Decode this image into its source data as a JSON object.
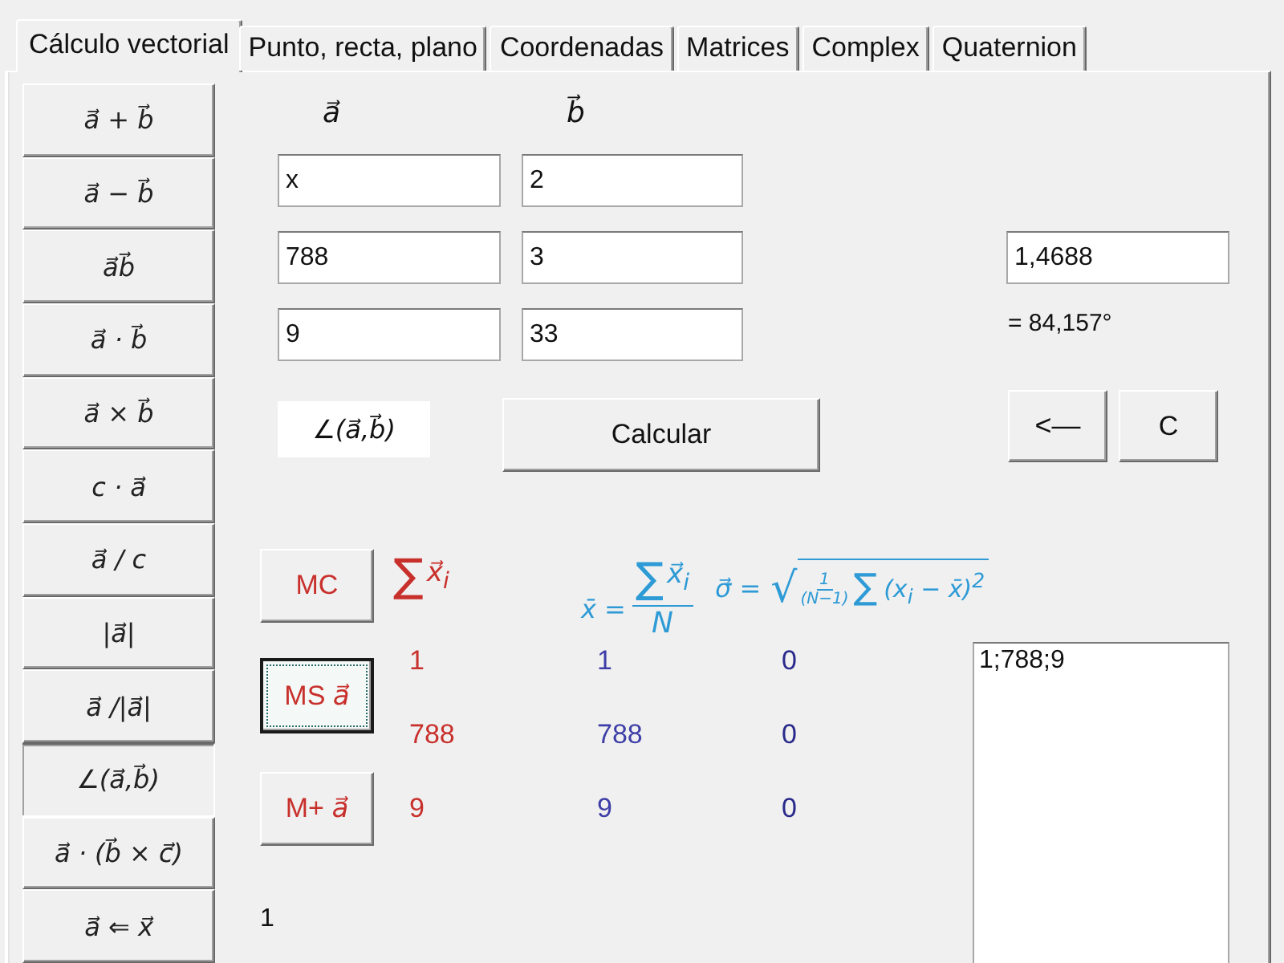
{
  "tabs": [
    {
      "label": "Cálculo vectorial",
      "selected": true
    },
    {
      "label": "Punto, recta, plano",
      "selected": false
    },
    {
      "label": "Coordenadas",
      "selected": false
    },
    {
      "label": "Matrices",
      "selected": false
    },
    {
      "label": "Complex",
      "selected": false
    },
    {
      "label": "Quaternion",
      "selected": false
    }
  ],
  "operations": [
    {
      "label": "a⃗ + b⃗",
      "selected": false
    },
    {
      "label": "a⃗ − b⃗",
      "selected": false
    },
    {
      "label": "a⃗b⃗",
      "selected": false
    },
    {
      "label": "a⃗ · b⃗",
      "selected": false
    },
    {
      "label": "a⃗ × b⃗",
      "selected": false
    },
    {
      "label": "c · a⃗",
      "selected": false
    },
    {
      "label": "a⃗ / c",
      "selected": false
    },
    {
      "label": "|a⃗|",
      "selected": false
    },
    {
      "label": "a⃗ /|a⃗|",
      "selected": false
    },
    {
      "label": "∠(a⃗,b⃗)",
      "selected": true
    },
    {
      "label": "a⃗ · (b⃗ × c⃗)",
      "selected": false
    },
    {
      "label": "a⃗ ⇐ x⃗",
      "selected": false
    }
  ],
  "vectors": {
    "headers": [
      "a⃗",
      "b⃗"
    ],
    "rows": [
      [
        "x",
        "2"
      ],
      [
        "788",
        "3"
      ],
      [
        "9",
        "33"
      ]
    ]
  },
  "result": {
    "value": "1,4688",
    "degrees": "= 84,157°"
  },
  "operation_label": "∠(a⃗,b⃗)",
  "buttons": {
    "calculate": "Calcular",
    "backspace": "<—",
    "clear": "C"
  },
  "memory": {
    "buttons": [
      {
        "label": "MC",
        "focused": false
      },
      {
        "label": "MS *a⃗*",
        "focused": true
      },
      {
        "label": "M+ *a⃗*",
        "focused": false
      }
    ],
    "sum_label": {
      "sign": "∑",
      "term": "x⃗$_{i}$"
    },
    "mean_formula": {
      "lhs": "x̄ =",
      "numerator_sign": "∑",
      "numerator_term": "x⃗$_{i}$",
      "denominator": "N"
    },
    "std_dev_formula": {
      "lhs": "σ⃗ =",
      "radical": "√",
      "coefficient_numerator": "1",
      "coefficient_denominator": "(N−1)",
      "sign": "∑",
      "body": "(x$_{i}$ − x̄)$^{2}$"
    },
    "rows": [
      [
        "1",
        "1",
        "0"
      ],
      [
        "788",
        "788",
        "0"
      ],
      [
        "9",
        "9",
        "0"
      ]
    ],
    "list": "1;788;9",
    "count": "1"
  }
}
